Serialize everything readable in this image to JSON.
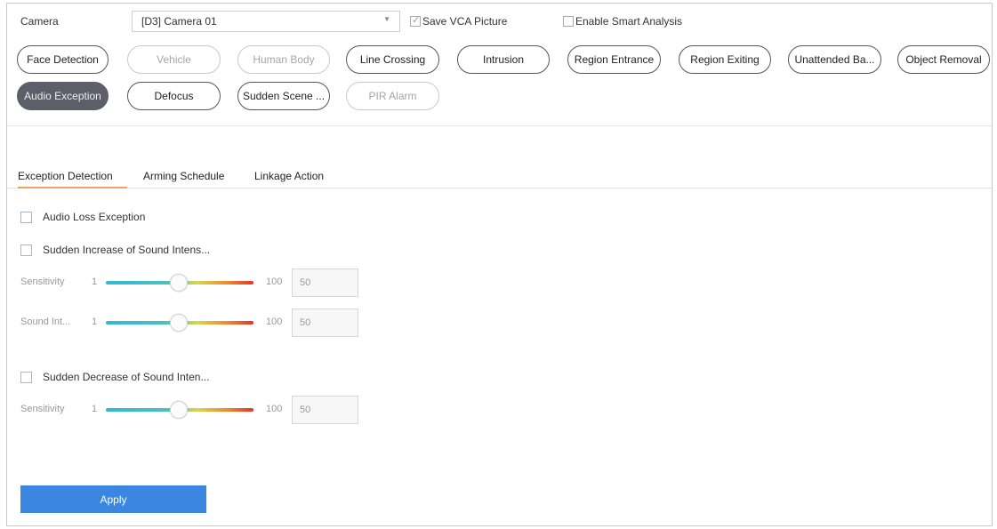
{
  "camera": {
    "label": "Camera",
    "selected": "[D3] Camera 01",
    "arrow_icon": "triangle-down-icon"
  },
  "options": {
    "save_vca": {
      "label": "Save VCA Picture",
      "checked": true
    },
    "smart_analysis": {
      "label": "Enable Smart Analysis",
      "checked": false
    }
  },
  "events": [
    {
      "label": "Face Detection",
      "state": "normal"
    },
    {
      "label": "Vehicle",
      "state": "disabled"
    },
    {
      "label": "Human Body",
      "state": "disabled"
    },
    {
      "label": "Line Crossing",
      "state": "normal"
    },
    {
      "label": "Intrusion",
      "state": "normal"
    },
    {
      "label": "Region Entrance",
      "state": "normal"
    },
    {
      "label": "Region Exiting",
      "state": "normal"
    },
    {
      "label": "Unattended Ba...",
      "state": "normal"
    },
    {
      "label": "Object Removal",
      "state": "normal"
    },
    {
      "label": "Audio Exception",
      "state": "active"
    },
    {
      "label": "Defocus",
      "state": "normal"
    },
    {
      "label": "Sudden Scene ...",
      "state": "normal"
    },
    {
      "label": "PIR Alarm",
      "state": "disabled"
    }
  ],
  "tabs": [
    {
      "label": "Exception Detection",
      "active": true
    },
    {
      "label": "Arming Schedule",
      "active": false
    },
    {
      "label": "Linkage Action",
      "active": false
    }
  ],
  "audio_loss": {
    "label": "Audio Loss Exception",
    "checked": false
  },
  "sudden_increase": {
    "label": "Sudden Increase of Sound Intens...",
    "checked": false,
    "sensitivity": {
      "label": "Sensitivity",
      "min": "1",
      "max": "100",
      "value": "50"
    },
    "sound_intensity": {
      "label": "Sound Int...",
      "min": "1",
      "max": "100",
      "value": "50"
    }
  },
  "sudden_decrease": {
    "label": "Sudden Decrease of Sound Inten...",
    "checked": false,
    "sensitivity": {
      "label": "Sensitivity",
      "min": "1",
      "max": "100",
      "value": "50"
    }
  },
  "apply_label": "Apply",
  "colors": {
    "active_pill": "#5e5e6b",
    "apply_button": "#3a86e0",
    "tab_underline": "#f0a060"
  }
}
